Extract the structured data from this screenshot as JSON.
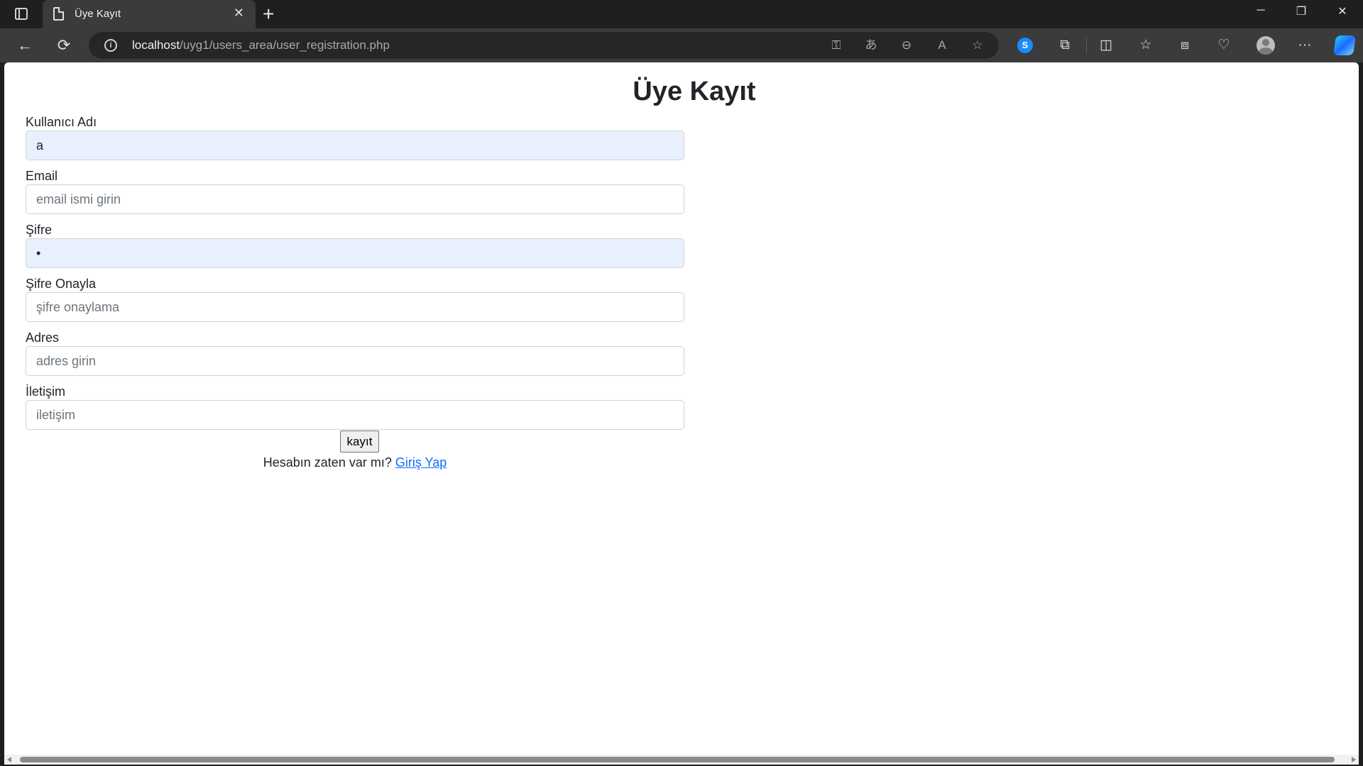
{
  "browser": {
    "tab": {
      "title": "Üye Kayıt",
      "close_icon": "close-icon",
      "page_icon": "document-icon"
    },
    "new_tab_glyph": "+",
    "window_controls": {
      "minimize": "─",
      "restore": "❐",
      "close": "✕"
    },
    "nav": {
      "back": "←",
      "reload": "⟳"
    },
    "address": {
      "host": "localhost",
      "path": "/uyg1/users_area/user_registration.php"
    },
    "omnibox_icons": {
      "key": "⚿",
      "translate": "あ",
      "zoom_out": "⊖",
      "read_aloud": "A",
      "favorite": "☆"
    },
    "toolbar_icons": {
      "extensions": "⧉",
      "split_screen": "◫",
      "favorites": "☆",
      "collections": "⧈",
      "browser_essentials": "♡",
      "more": "···"
    }
  },
  "page": {
    "title": "Üye Kayıt",
    "form": {
      "username": {
        "label": "Kullanıcı Adı",
        "value": "a",
        "placeholder": ""
      },
      "email": {
        "label": "Email",
        "value": "",
        "placeholder": "email ismi girin"
      },
      "password": {
        "label": "Şifre",
        "value": "a",
        "placeholder": ""
      },
      "confirm_password": {
        "label": "Şifre Onayla",
        "value": "",
        "placeholder": "şifre onaylama"
      },
      "address": {
        "label": "Adres",
        "value": "",
        "placeholder": "adres girin"
      },
      "contact": {
        "label": "İletişim",
        "value": "",
        "placeholder": "iletişim"
      },
      "submit_label": "kayıt"
    },
    "login_prompt": "Hesabın zaten var mı?",
    "login_link": "Giriş Yap"
  }
}
